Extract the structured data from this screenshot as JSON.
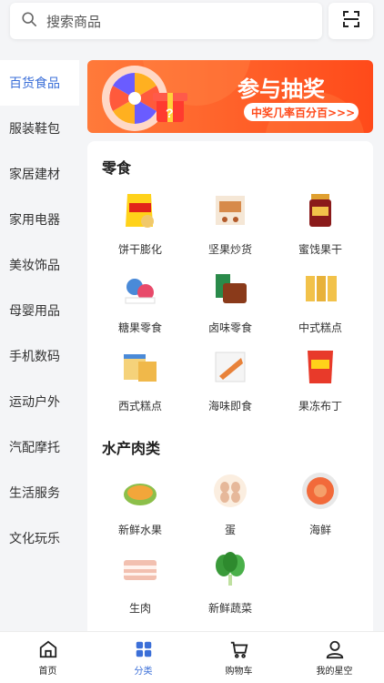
{
  "search": {
    "placeholder": "搜索商品",
    "icon": "search-icon",
    "scan_icon": "scan-icon"
  },
  "sidebar": {
    "items": [
      {
        "label": "百货食品",
        "active": true
      },
      {
        "label": "服装鞋包"
      },
      {
        "label": "家居建材"
      },
      {
        "label": "家用电器"
      },
      {
        "label": "美妆饰品"
      },
      {
        "label": "母婴用品"
      },
      {
        "label": "手机数码"
      },
      {
        "label": "运动户外"
      },
      {
        "label": "汽配摩托"
      },
      {
        "label": "生活服务"
      },
      {
        "label": "文化玩乐"
      }
    ]
  },
  "banner": {
    "title": "参与抽奖",
    "subtitle": "中奖几率百分百>>>",
    "colors": {
      "start": "#ff5a1f",
      "end": "#ff9a3c"
    }
  },
  "sections": [
    {
      "title": "零食",
      "items": [
        {
          "label": "饼干膨化",
          "icon": "chips-bag"
        },
        {
          "label": "坚果炒货",
          "icon": "nuts-box"
        },
        {
          "label": "蜜饯果干",
          "icon": "dried-fruit-jar"
        },
        {
          "label": "糖果零食",
          "icon": "candy"
        },
        {
          "label": "卤味零食",
          "icon": "braised-snack"
        },
        {
          "label": "中式糕点",
          "icon": "chinese-pastry"
        },
        {
          "label": "西式糕点",
          "icon": "western-pastry"
        },
        {
          "label": "海味即食",
          "icon": "seafood-snack"
        },
        {
          "label": "果冻布丁",
          "icon": "jelly-pudding"
        }
      ]
    },
    {
      "title": "水产肉类",
      "items": [
        {
          "label": "新鲜水果",
          "icon": "melon"
        },
        {
          "label": "蛋",
          "icon": "eggs"
        },
        {
          "label": "海鲜",
          "icon": "shrimp-plate"
        },
        {
          "label": "生肉",
          "icon": "pork-belly"
        },
        {
          "label": "新鲜蔬菜",
          "icon": "greens"
        }
      ]
    }
  ],
  "tabbar": {
    "items": [
      {
        "label": "首页",
        "icon": "home-icon"
      },
      {
        "label": "分类",
        "icon": "category-icon",
        "active": true
      },
      {
        "label": "购物车",
        "icon": "cart-icon"
      },
      {
        "label": "我的星空",
        "icon": "user-icon"
      }
    ]
  },
  "colors": {
    "accent": "#3b6fd8",
    "banner": "#ff6a2a"
  }
}
